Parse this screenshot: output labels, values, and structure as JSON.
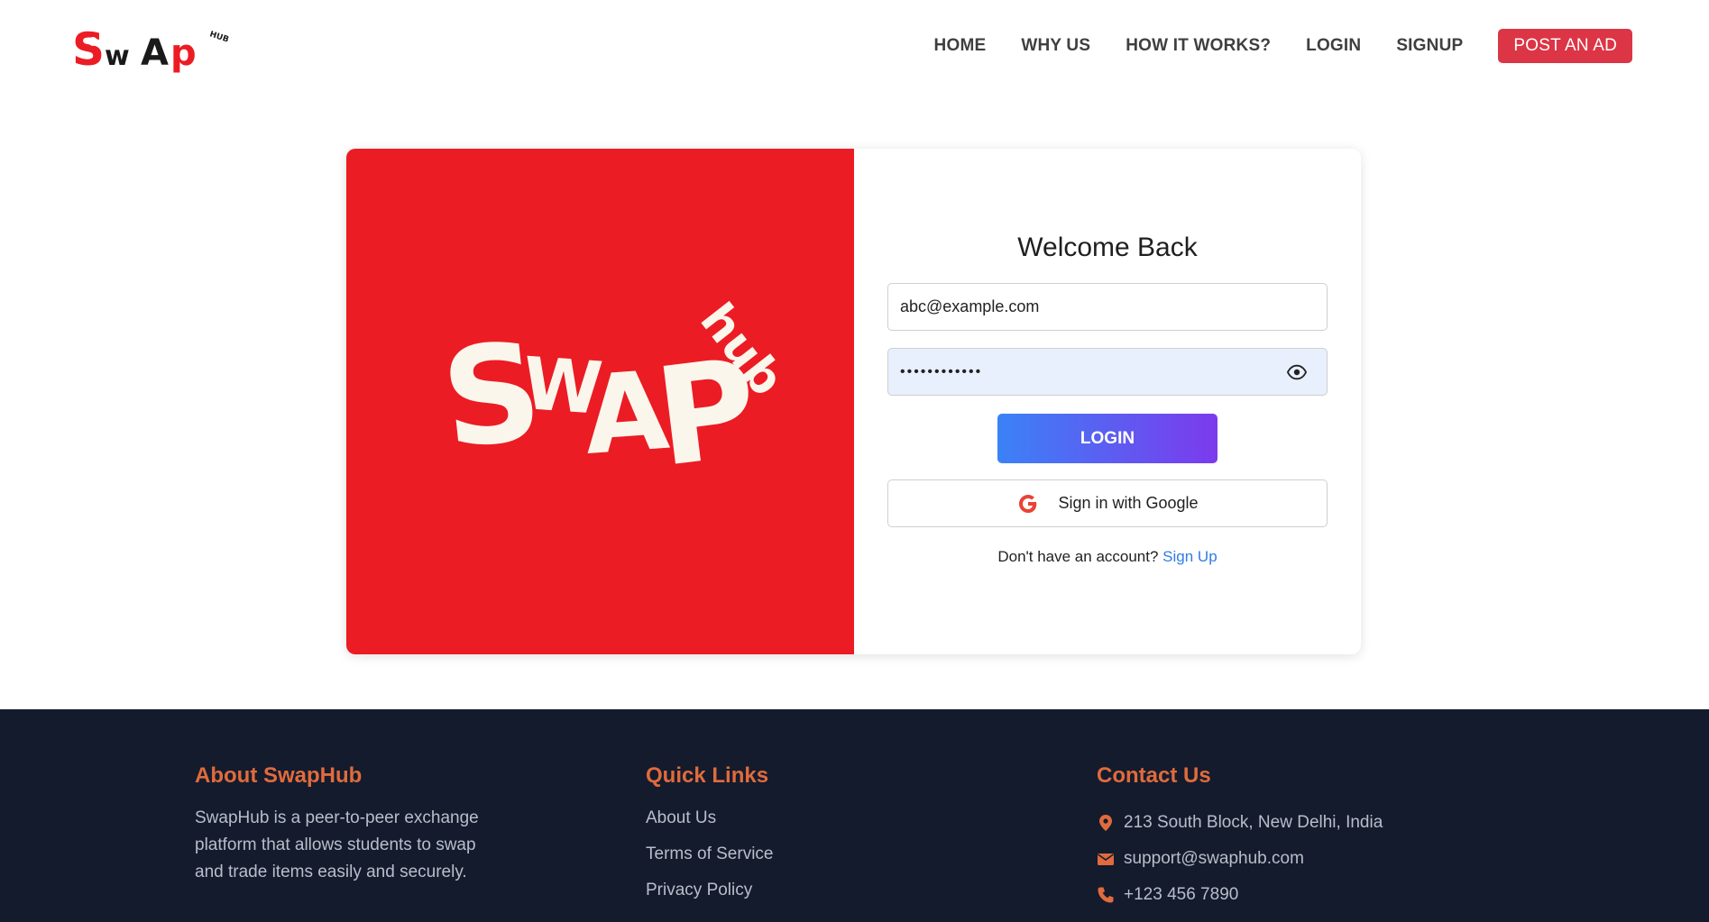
{
  "brand": {
    "name": "SwapHub",
    "logo_small": {
      "main": "SwAp",
      "sub": "HUB"
    },
    "logo_big": {
      "main": "SWAP",
      "sub": "hub"
    }
  },
  "nav": {
    "items": [
      "HOME",
      "WHY US",
      "HOW IT WORKS?",
      "LOGIN",
      "SIGNUP"
    ],
    "post_ad": "POST AN AD"
  },
  "login": {
    "title": "Welcome Back",
    "email_value": "abc@example.com",
    "password_value": "••••••••••••",
    "login_label": "LOGIN",
    "google_label": "Sign in with Google",
    "no_account_text": "Don't have an account?",
    "signup_link": "Sign Up"
  },
  "footer": {
    "about": {
      "title": "About SwapHub",
      "text": "SwapHub is a peer-to-peer exchange platform that allows students to swap and trade items easily and securely."
    },
    "links": {
      "title": "Quick Links",
      "items": [
        "About Us",
        "Terms of Service",
        "Privacy Policy"
      ]
    },
    "contact": {
      "title": "Contact Us",
      "address": "213 South Block, New Delhi, India",
      "email": "support@swaphub.com",
      "phone": "+123 456 7890"
    }
  },
  "colors": {
    "brand_red": "#ec1c24",
    "button_red": "#dc3545",
    "footer_bg": "#141b2d",
    "footer_heading": "#e06b3c",
    "link_blue": "#2f7de1"
  },
  "icons": [
    "eye-icon",
    "google-icon",
    "location-icon",
    "mail-icon",
    "phone-icon"
  ]
}
